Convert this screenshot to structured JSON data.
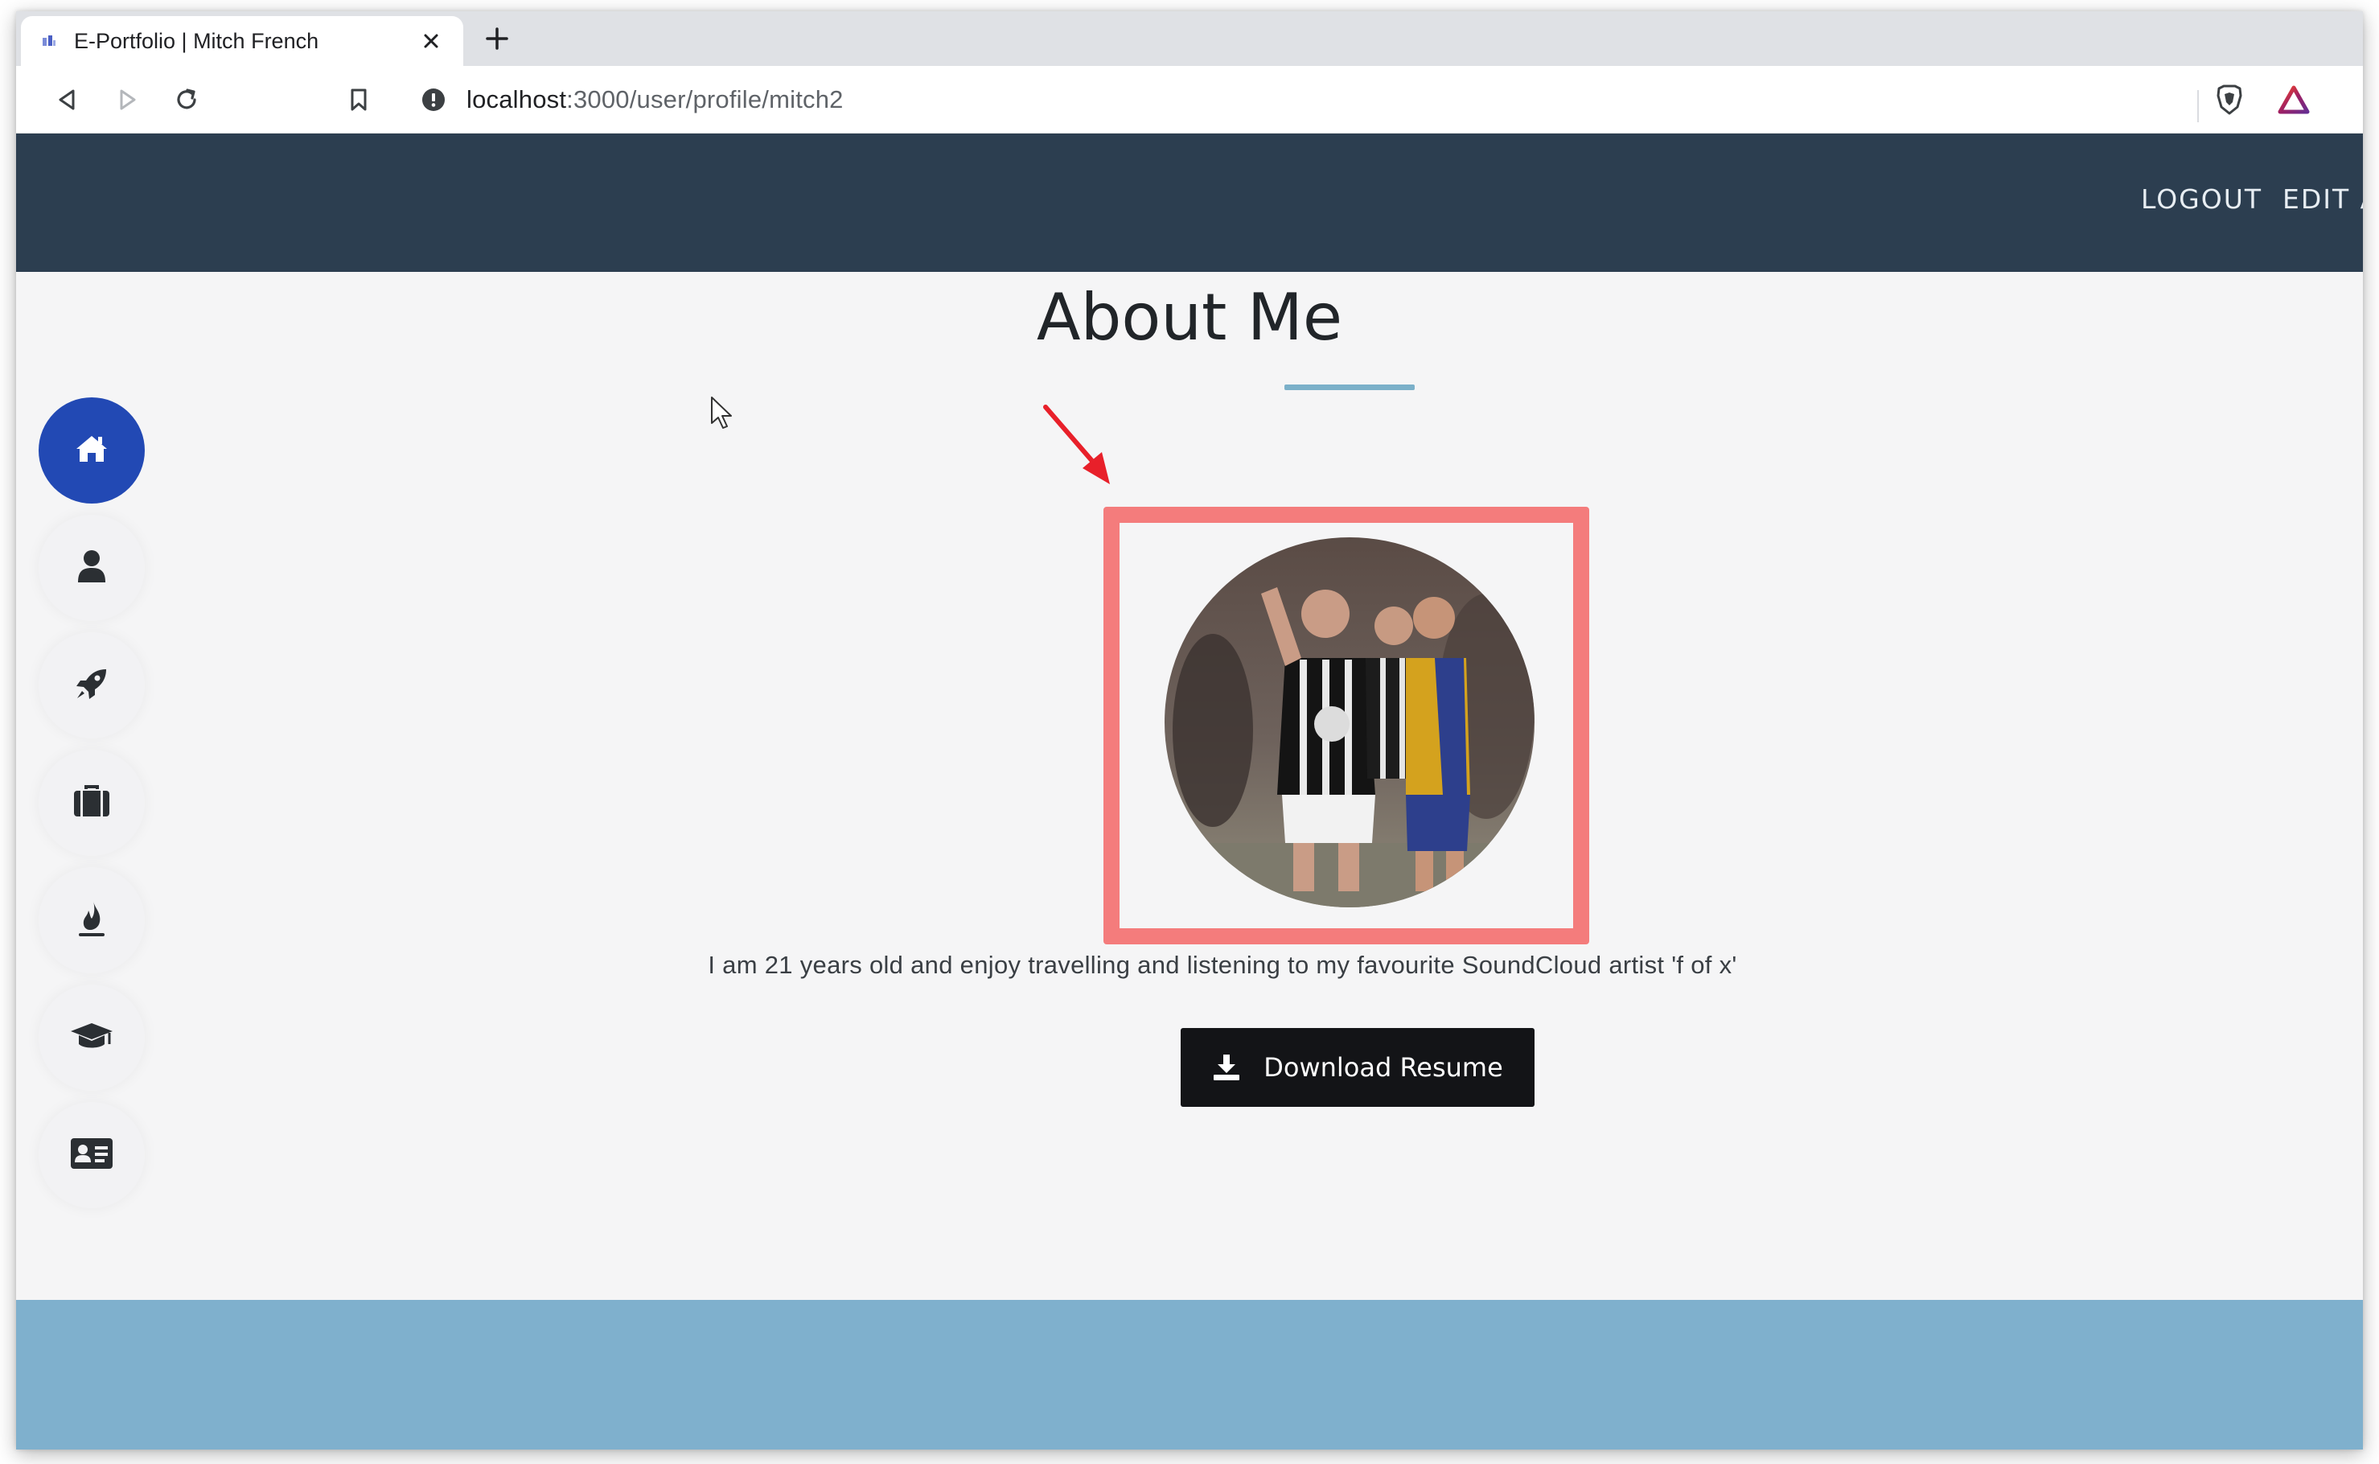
{
  "browser": {
    "tab_title": "E-Portfolio | Mitch French",
    "url_host": "localhost",
    "url_path": ":3000/user/profile/mitch2"
  },
  "header": {
    "links": [
      {
        "label": "LOGOUT"
      },
      {
        "label": "EDIT A"
      }
    ]
  },
  "sidebar": {
    "items": [
      {
        "icon": "home-icon",
        "active": true
      },
      {
        "icon": "user-icon",
        "active": false
      },
      {
        "icon": "rocket-icon",
        "active": false
      },
      {
        "icon": "briefcase-icon",
        "active": false
      },
      {
        "icon": "fire-icon",
        "active": false
      },
      {
        "icon": "graduation-cap-icon",
        "active": false
      },
      {
        "icon": "id-card-icon",
        "active": false
      }
    ]
  },
  "about": {
    "title": "About Me",
    "bio": "I am 21 years old and enjoy travelling and listening to my favourite SoundCloud artist 'f of x'",
    "download_label": "Download Resume"
  },
  "colors": {
    "header_bg": "#2c3e50",
    "accent_blue": "#2249b4",
    "footer_bg": "#7fb0cd",
    "highlight_box": "#f47c7c",
    "annotation_arrow": "#e8202a"
  }
}
